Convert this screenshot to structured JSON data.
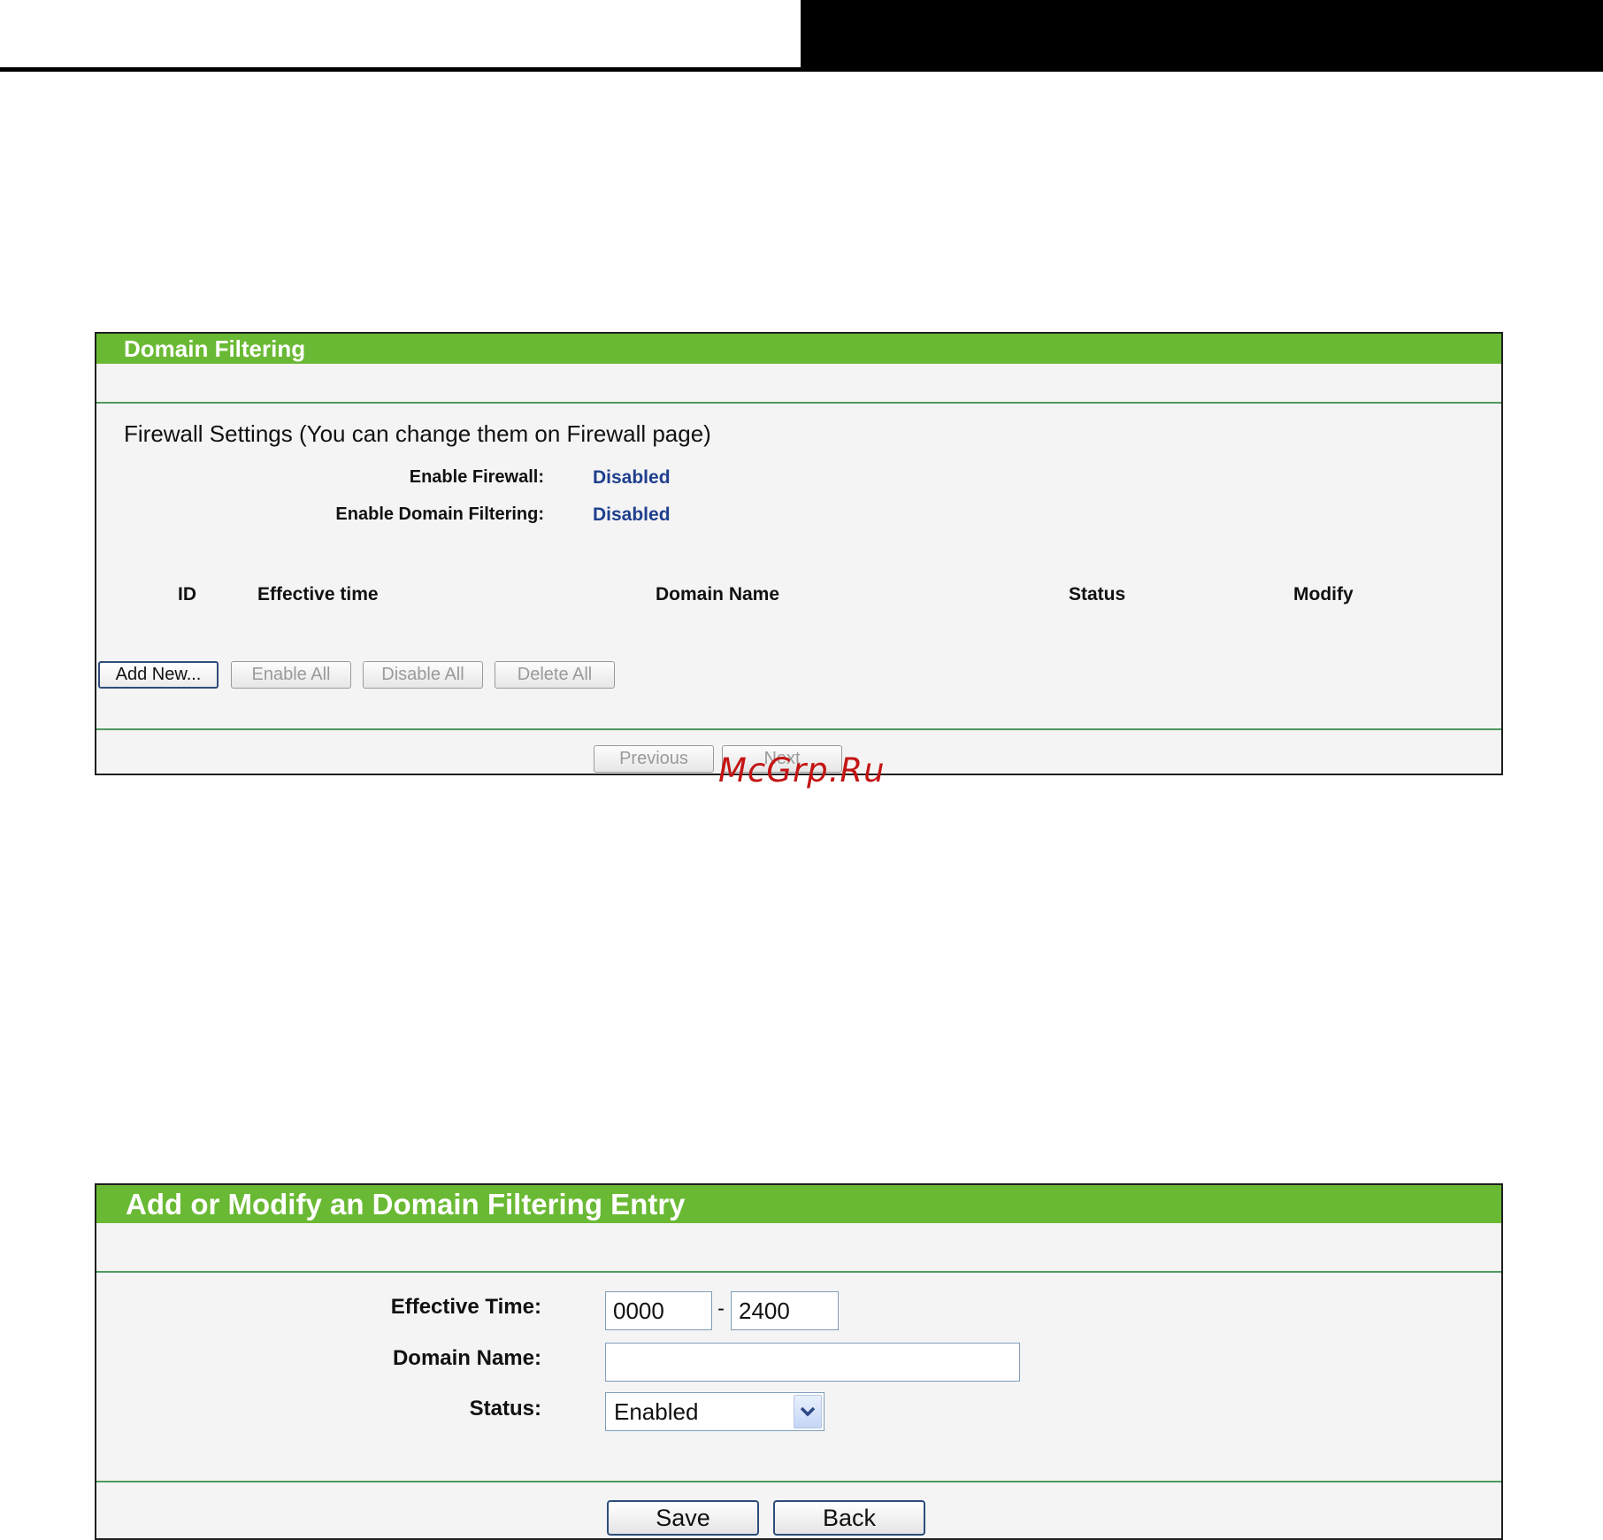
{
  "domain_filtering": {
    "title": "Domain Filtering",
    "section_heading": "Firewall Settings (You can change them on Firewall page)",
    "enable_firewall_label": "Enable Firewall:",
    "enable_firewall_value": "Disabled",
    "enable_domain_filtering_label": "Enable Domain Filtering:",
    "enable_domain_filtering_value": "Disabled",
    "columns": [
      "ID",
      "Effective time",
      "Domain Name",
      "Status",
      "Modify"
    ],
    "buttons": {
      "add_new": "Add New...",
      "enable_all": "Enable All",
      "disable_all": "Disable All",
      "delete_all": "Delete All",
      "previous": "Previous",
      "next": "Next"
    }
  },
  "entry_form": {
    "title": "Add or Modify an Domain Filtering Entry",
    "effective_time_label": "Effective Time:",
    "effective_time_start": "0000",
    "effective_time_separator": "-",
    "effective_time_end": "2400",
    "domain_name_label": "Domain Name:",
    "domain_name_value": "",
    "status_label": "Status:",
    "status_value": "Enabled",
    "save_label": "Save",
    "back_label": "Back"
  },
  "watermark": "McGrp.Ru",
  "colors": {
    "header_green": "#6ab934",
    "value_blue": "#1f3f8e",
    "rule_green": "#4f9a5f",
    "watermark_red": "#c41414"
  }
}
